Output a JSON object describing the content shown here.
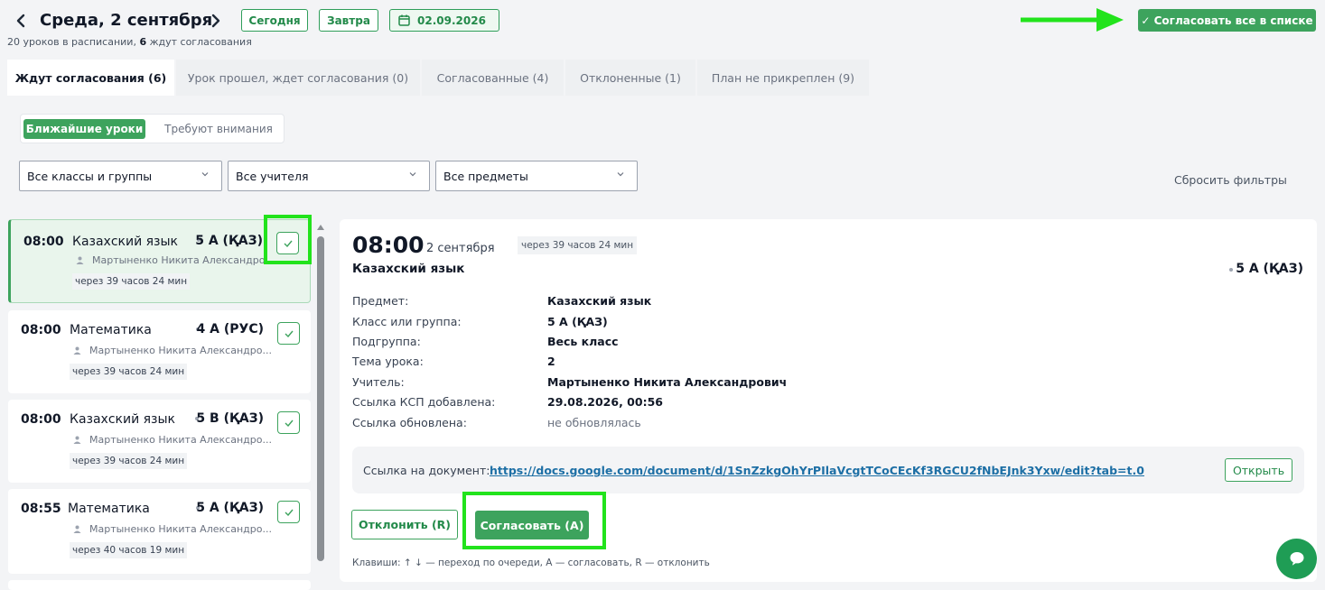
{
  "header": {
    "title": "Среда, 2 сентября",
    "subtitle_count": "20",
    "subtitle_mid": " уроков в расписании, ",
    "subtitle_pending": "6",
    "subtitle_end": " ждут согласования",
    "today_label": "Сегодня",
    "tomorrow_label": "Завтра",
    "date_value": "02.09.2026",
    "approve_all_label": "✓ Согласовать все в списке"
  },
  "tabs": [
    {
      "label": "Ждут согласования (6)"
    },
    {
      "label": "Урок прошел, ждет согласования (0)"
    },
    {
      "label": "Согласованные (4)"
    },
    {
      "label": "Отклоненные (1)"
    },
    {
      "label": "План не прикреплен (9)"
    }
  ],
  "subtabs": {
    "active": "Ближайшие уроки",
    "other": "Требуют внимания"
  },
  "filters": {
    "classes": "Все классы и группы",
    "teachers": "Все учителя",
    "subjects": "Все предметы",
    "reset_label": "Сбросить фильтры"
  },
  "lessons": [
    {
      "time": "08:00",
      "subject": "Казахский язык",
      "class": "5 А (ҚАЗ)",
      "teacher": "Мартыненко Никита Александро...",
      "badge": "через 39 часов 24 мин"
    },
    {
      "time": "08:00",
      "subject": "Математика",
      "class": "4 А (РУС)",
      "teacher": "Мартыненко Никита Александро...",
      "badge": "через 39 часов 24 мин"
    },
    {
      "time": "08:00",
      "subject": "Казахский язык",
      "class": "5 В (ҚАЗ)",
      "teacher": "Мартыненко Никита Александро...",
      "badge": "через 39 часов 24 мин"
    },
    {
      "time": "08:55",
      "subject": "Математика",
      "class": "5 А (ҚАЗ)",
      "teacher": "Мартыненко Никита Александро...",
      "badge": "через 40 часов 19 мин"
    }
  ],
  "detail": {
    "time": "08:00",
    "date": "2 сентября",
    "badge": "через 39 часов 24 мин",
    "subject": "Казахский язык",
    "class": "5 А (ҚАЗ)",
    "fields": [
      {
        "label": "Предмет:",
        "value": "Казахский язык"
      },
      {
        "label": "Класс или группа:",
        "value": "5 А (ҚАЗ)"
      },
      {
        "label": "Подгруппа:",
        "value": "Весь класс"
      },
      {
        "label": "Тема урока:",
        "value": "2"
      },
      {
        "label": "Учитель:",
        "value": "Мартыненко Никита Александрович"
      },
      {
        "label": "Ссылка КСП добавлена:",
        "value": "29.08.2026, 00:56"
      },
      {
        "label": "Ссылка обновлена:",
        "value": "не обновлялась"
      }
    ],
    "link_label": "Ссылка на документ:",
    "link_url": "https://docs.google.com/document/d/1SnZzkgOhYrPIlaVcgtTCoCEcKf3RGCU2fNbEJnk3Yxw/edit?tab=t.0",
    "open_label": "Открыть",
    "reject_label": "Отклонить (R)",
    "approve_label": "Согласовать (A)",
    "hint": "Клавиши: ↑ ↓ — переход по очереди, A — согласовать, R — отклонить"
  },
  "colors": {
    "accent": "#3da35d",
    "highlight": "#22e31c",
    "link": "#1d6fa5"
  }
}
